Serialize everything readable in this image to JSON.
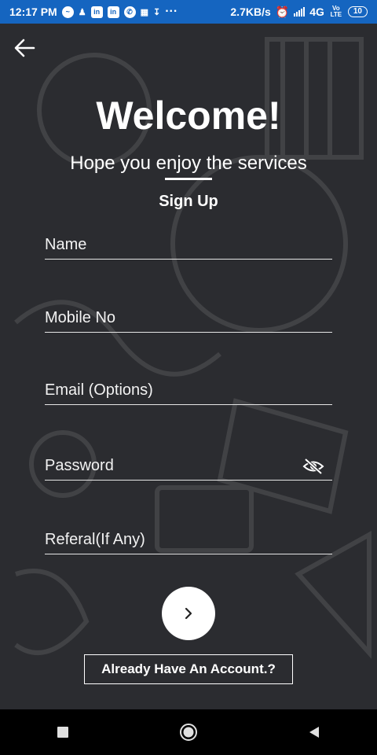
{
  "status_bar": {
    "time": "12:17 PM",
    "network_speed": "2.7KB/s",
    "network_type": "4G",
    "volte": "Vo LTE",
    "battery": "10",
    "more": "···",
    "notification_icons": [
      "messenger-icon",
      "person-icon",
      "linkedin-icon",
      "linkedin-icon",
      "whatsapp-icon",
      "gallery-icon",
      "download-icon"
    ]
  },
  "header": {
    "back_icon": "arrow-left-icon",
    "title": "Welcome!",
    "subtitle": "Hope you enjoy the services"
  },
  "form": {
    "section_title": "Sign Up",
    "fields": [
      {
        "label": "Name"
      },
      {
        "label": "Mobile No"
      },
      {
        "label": "Email (Options)"
      },
      {
        "label": "Password",
        "icon": "eye-off-icon"
      },
      {
        "label": "Referal(If Any)"
      }
    ],
    "submit_icon": "chevron-right-icon",
    "login_link": "Already Have An Account.?"
  },
  "nav_bar": {
    "items": [
      "recents-icon",
      "home-icon",
      "back-icon"
    ]
  }
}
